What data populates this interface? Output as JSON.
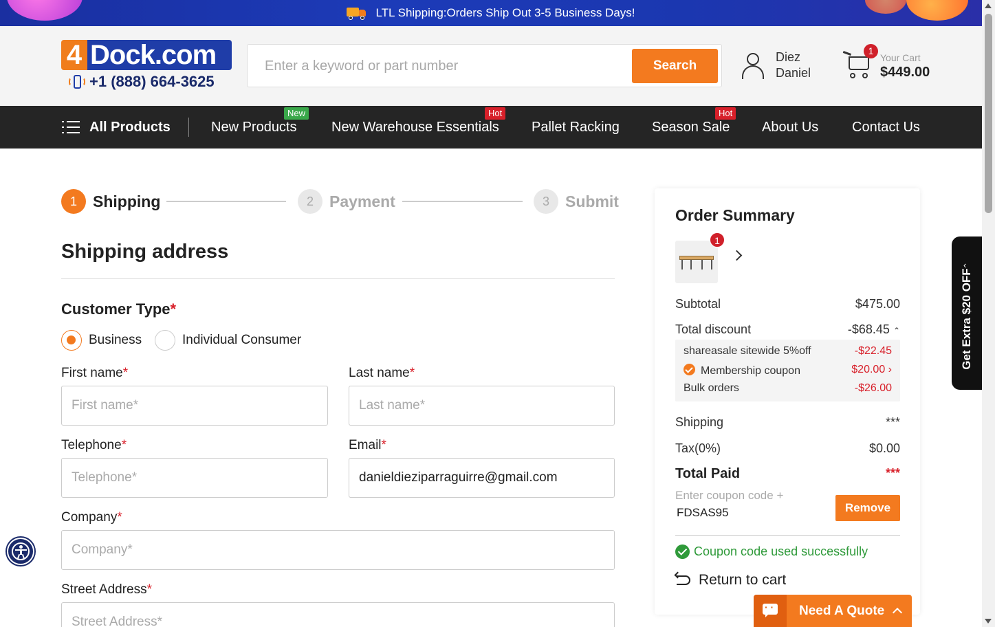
{
  "banner": {
    "text": "LTL Shipping:Orders Ship Out 3-5 Business Days!"
  },
  "header": {
    "logo_prefix": "4",
    "logo_word": "Dock.com",
    "phone": "+1 (888) 664-3625",
    "search_placeholder": "Enter a keyword or part number",
    "search_button": "Search",
    "user_first": "Diez",
    "user_last": "Daniel",
    "cart_count": "1",
    "cart_label": "Your Cart",
    "cart_total": "$449.00"
  },
  "nav": {
    "all_products": "All Products",
    "items": [
      {
        "label": "New Products",
        "tag": "New"
      },
      {
        "label": "New Warehouse Essentials",
        "tag": "Hot"
      },
      {
        "label": "Pallet Racking",
        "tag": ""
      },
      {
        "label": "Season Sale",
        "tag": "Hot"
      },
      {
        "label": "About Us",
        "tag": ""
      },
      {
        "label": "Contact Us",
        "tag": ""
      }
    ]
  },
  "steps": [
    {
      "num": "1",
      "label": "Shipping"
    },
    {
      "num": "2",
      "label": "Payment"
    },
    {
      "num": "3",
      "label": "Submit"
    }
  ],
  "form": {
    "title": "Shipping address",
    "customer_type_label": "Customer Type",
    "required_mark": "*",
    "customer_types": [
      "Business",
      "Individual Consumer"
    ],
    "selected_type": "Business",
    "first_name_label": "First name",
    "first_name_placeholder": "First name*",
    "last_name_label": "Last name",
    "last_name_placeholder": "Last name*",
    "telephone_label": "Telephone",
    "telephone_placeholder": "Telephone*",
    "email_label": "Email",
    "email_value": "danieldieziparraguirre@gmail.com",
    "company_label": "Company",
    "company_placeholder": "Company*",
    "street_label": "Street Address",
    "street_placeholder": "Street Address*"
  },
  "summary": {
    "title": "Order Summary",
    "item_count": "1",
    "subtotal_label": "Subtotal",
    "subtotal_value": "$475.00",
    "discount_label": "Total discount",
    "discount_value": "-$68.45",
    "discounts": [
      {
        "label": "shareasale sitewide 5%off",
        "value": "-$22.45"
      },
      {
        "label": "Membership coupon",
        "value": "$20.00"
      },
      {
        "label": "Bulk orders",
        "value": "-$26.00"
      }
    ],
    "shipping_label": "Shipping",
    "shipping_value": "***",
    "tax_label": "Tax(0%)",
    "tax_value": "$0.00",
    "total_label": "Total Paid",
    "total_value": "***",
    "coupon_placeholder": "Enter coupon code +",
    "coupon_code": "FDSAS95",
    "remove_button": "Remove",
    "success_text": "Coupon code used successfully",
    "return_text": "Return to cart"
  },
  "promo": {
    "text": "Get Extra $20 OFF"
  },
  "quote": {
    "text": "Need A Quote"
  },
  "colors": {
    "accent": "#f37a1f",
    "brand_blue": "#1f3da8",
    "nav_bg": "#252525",
    "error": "#d8202a",
    "success": "#2f9a3a"
  }
}
